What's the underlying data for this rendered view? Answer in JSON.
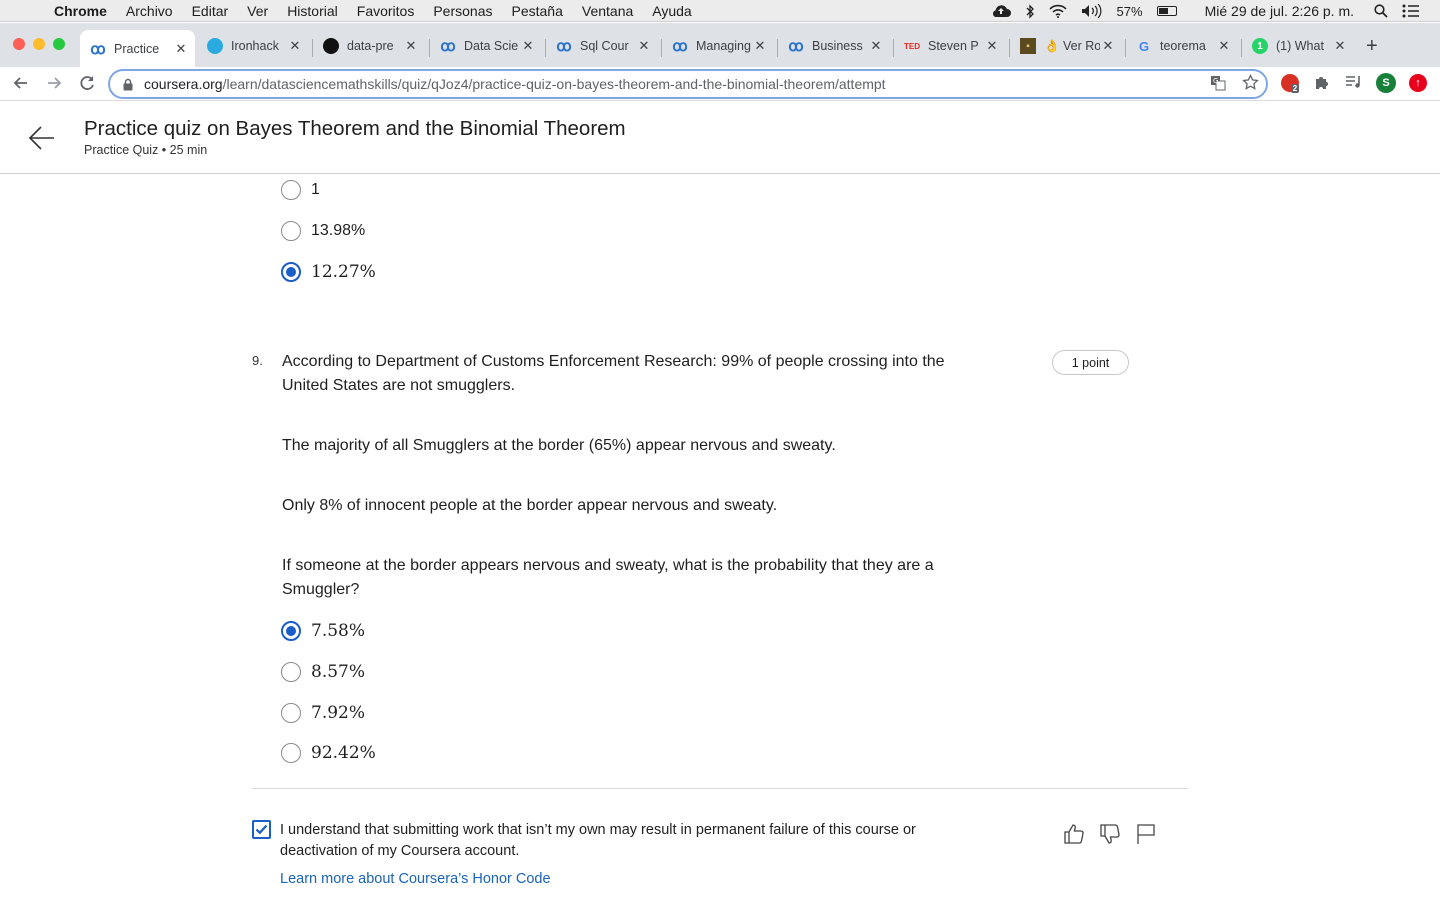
{
  "menubar": {
    "app": "Chrome",
    "items": [
      "Archivo",
      "Editar",
      "Ver",
      "Historial",
      "Favoritos",
      "Personas",
      "Pestaña",
      "Ventana",
      "Ayuda"
    ],
    "battery": "57%",
    "battery_level": 0.57,
    "datetime": "Mié 29 de jul.  2:26 p. m."
  },
  "tabs": [
    {
      "title": "Practice",
      "favicon": "coursera-icon",
      "active": true
    },
    {
      "title": "Ironhack",
      "favicon": "ironhack-icon"
    },
    {
      "title": "data-pre",
      "favicon": "github-icon"
    },
    {
      "title": "Data Scie",
      "favicon": "coursera-icon"
    },
    {
      "title": "Sql Cour",
      "favicon": "coursera-icon"
    },
    {
      "title": "Managing",
      "favicon": "coursera-icon"
    },
    {
      "title": "Business",
      "favicon": "coursera-icon"
    },
    {
      "title": "Steven P",
      "favicon": "ted-icon",
      "favicon_text": "TED"
    },
    {
      "title": "👌 Ver Ro",
      "favicon": "folder-icon"
    },
    {
      "title": "teorema",
      "favicon": "google-icon",
      "favicon_text": "G"
    },
    {
      "title": "(1) What",
      "favicon": "whatsapp-icon",
      "favicon_text": "1"
    }
  ],
  "toolbar": {
    "url_domain": "coursera.org",
    "url_path": "/learn/datasciencemathskills/quiz/qJoz4/practice-quiz-on-bayes-theorem-and-the-binomial-theorem/attempt",
    "ext_badge": "2",
    "profile_initial": "S"
  },
  "header": {
    "title": "Practice quiz on Bayes Theorem and the Binomial Theorem",
    "subtitle": "Practice Quiz • 25 min"
  },
  "prev_question": {
    "options": [
      {
        "label": "1",
        "selected": false,
        "math": false
      },
      {
        "label": "13.98%",
        "selected": false,
        "math": false
      },
      {
        "label": "12.27%",
        "selected": true,
        "math": true
      }
    ]
  },
  "question9": {
    "number": "9.",
    "points": "1 point",
    "line1": "According to Department of Customs Enforcement Research: 99% of people crossing into the United States are not smugglers.",
    "line2": "The majority of all Smugglers at the border (65%) appear nervous and sweaty.",
    "line3": "Only 8% of innocent people at the border appear nervous and sweaty.",
    "line4": "If someone at the border appears nervous and sweaty, what is the probability that they are a Smuggler?",
    "options": [
      {
        "label": "7.58%",
        "selected": true
      },
      {
        "label": "8.57%",
        "selected": false
      },
      {
        "label": "7.92%",
        "selected": false
      },
      {
        "label": "92.42%",
        "selected": false
      }
    ]
  },
  "honor": {
    "checked": true,
    "text": "I understand that submitting work that isn’t my own may result in permanent failure of this course or deactivation of my Coursera account.",
    "link": "Learn more about Coursera’s Honor Code"
  },
  "colors": {
    "accent": "#1a5ec8",
    "link": "#1a63b8"
  }
}
